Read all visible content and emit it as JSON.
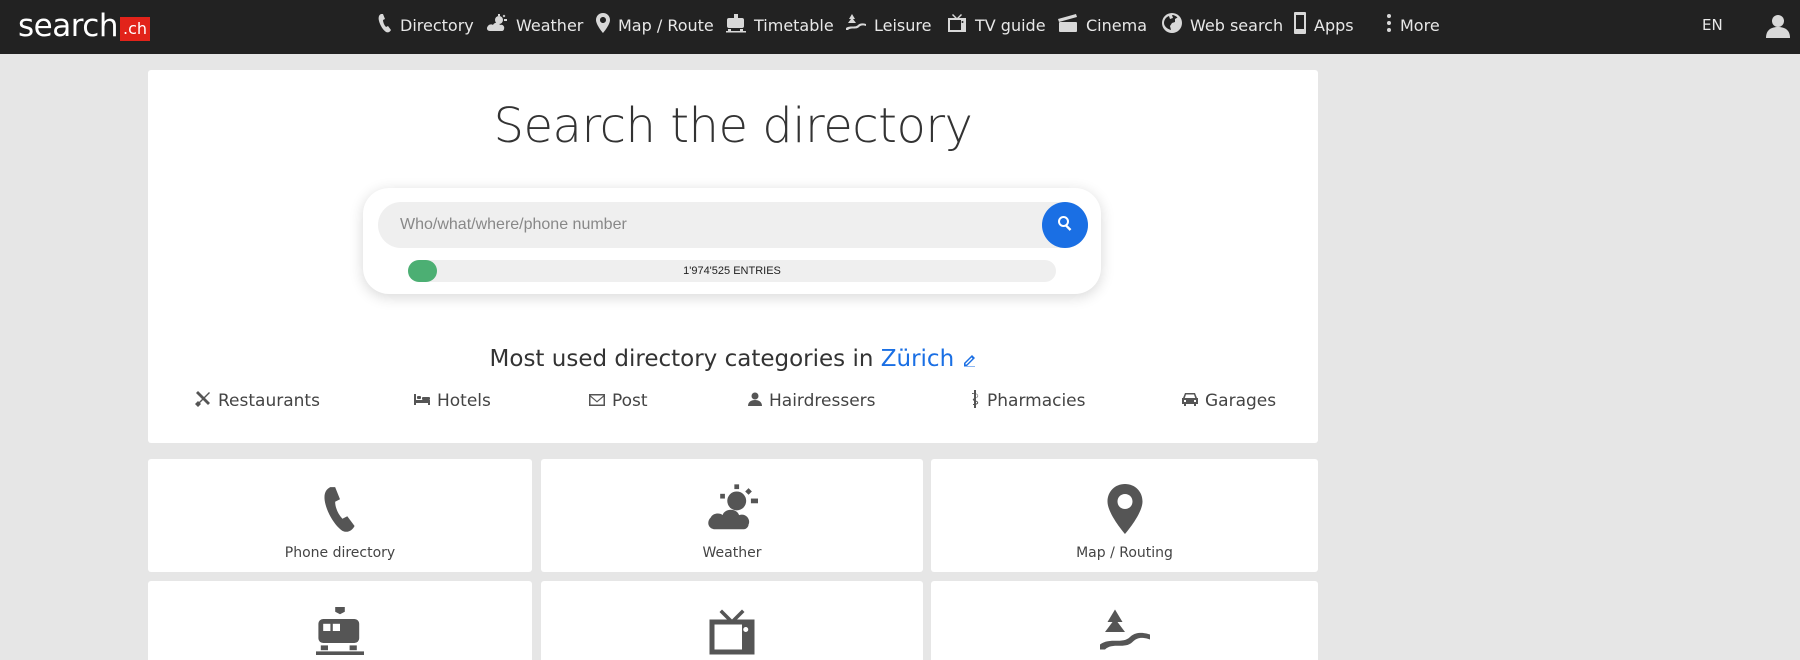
{
  "header": {
    "logo_text": "search",
    "logo_suffix": ".ch",
    "nav": [
      {
        "label": "Directory",
        "icon": "phone-icon"
      },
      {
        "label": "Weather",
        "icon": "weather-icon"
      },
      {
        "label": "Map / Route",
        "icon": "map-pin-icon"
      },
      {
        "label": "Timetable",
        "icon": "train-icon"
      },
      {
        "label": "Leisure",
        "icon": "leisure-icon"
      },
      {
        "label": "TV guide",
        "icon": "tv-icon"
      },
      {
        "label": "Cinema",
        "icon": "clapper-icon"
      },
      {
        "label": "Web search",
        "icon": "globe-icon"
      },
      {
        "label": "Apps",
        "icon": "mobile-icon"
      },
      {
        "label": "More",
        "icon": "more-vertical-icon"
      }
    ],
    "language": "EN"
  },
  "search": {
    "title": "Search the directory",
    "placeholder": "Who/what/where/phone number",
    "entries_label": "1'974'525  ENTRIES",
    "progress_fraction": 0.045
  },
  "categories": {
    "heading": "Most used directory categories in",
    "city": "Zürich",
    "items": [
      {
        "label": "Restaurants",
        "icon": "cutlery-icon"
      },
      {
        "label": "Hotels",
        "icon": "bed-icon"
      },
      {
        "label": "Post",
        "icon": "envelope-icon"
      },
      {
        "label": "Hairdressers",
        "icon": "person-icon"
      },
      {
        "label": "Pharmacies",
        "icon": "pharmacy-icon"
      },
      {
        "label": "Garages",
        "icon": "car-icon"
      }
    ]
  },
  "tiles": [
    {
      "label": "Phone directory",
      "icon": "phone-icon"
    },
    {
      "label": "Weather",
      "icon": "weather-icon"
    },
    {
      "label": "Map / Routing",
      "icon": "map-pin-icon"
    },
    {
      "label": "",
      "icon": "train-icon"
    },
    {
      "label": "",
      "icon": "tv-icon"
    },
    {
      "label": "",
      "icon": "leisure-icon"
    }
  ],
  "colors": {
    "topbar": "#222222",
    "accent_blue": "#1a6fe4",
    "logo_red": "#e2231a",
    "progress_green": "#4caf73",
    "page_bg": "#e6e6e6"
  }
}
